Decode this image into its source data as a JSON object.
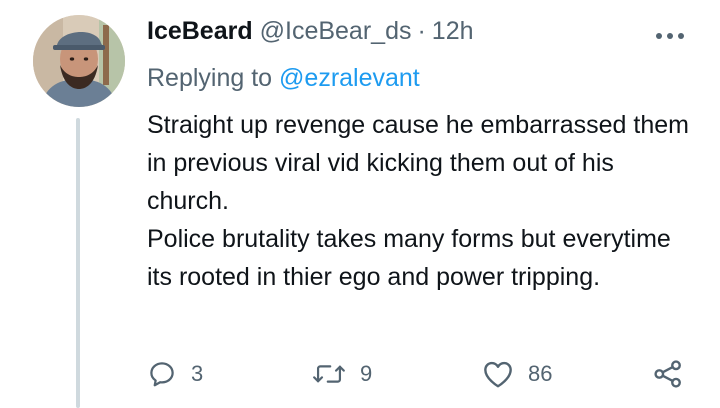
{
  "author": {
    "display_name": "IceBeard",
    "handle": "@IceBear_ds",
    "separator": "·",
    "time": "12h"
  },
  "reply": {
    "prefix": "Replying to",
    "mention": "@ezralevant"
  },
  "body": {
    "paragraph1": "Straight up revenge cause he embarrassed them in previous viral vid kicking them out of his church.",
    "paragraph2": "Police brutality takes many forms but everytime its rooted in thier ego and power tripping."
  },
  "actions": {
    "replies": "3",
    "retweets": "9",
    "likes": "86"
  },
  "icons": {
    "more": "more-icon",
    "reply": "reply-icon",
    "retweet": "retweet-icon",
    "like": "heart-icon",
    "share": "share-icon"
  },
  "colors": {
    "text": "#0f1419",
    "secondary": "#536471",
    "link": "#1d9bf0",
    "thread_line": "#cfd9de"
  }
}
